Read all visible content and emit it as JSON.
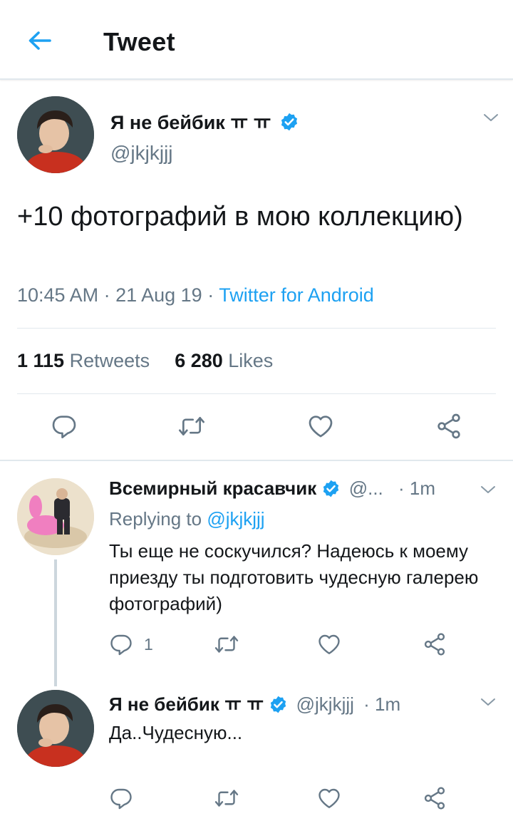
{
  "header": {
    "title": "Tweet"
  },
  "main_tweet": {
    "name": "Я не бейбик ㅠ ㅠ",
    "handle": "@jkjkjjj",
    "text": "+10 фотографий в мою коллекцию)",
    "time": "10:45 AM · 21 Aug 19 · ",
    "source": "Twitter for Android",
    "retweets_count": "1 115",
    "retweets_label": "Retweets",
    "likes_count": "6 280",
    "likes_label": "Likes"
  },
  "replies": [
    {
      "name": "Всемирный красавчик",
      "handle": "@...",
      "age": "· 1m",
      "replying_prefix": "Replying to ",
      "replying_to": "@jkjkjjj",
      "text": "Ты еще не соскучился? Надеюсь к моему приезду ты подготовить чудесную галерею фотографий)",
      "reply_count": "1"
    },
    {
      "name": "Я не бейбик ㅠ ㅠ",
      "handle": "@jkjkjjj",
      "age": "· 1m",
      "text": "Да..Чудесную..."
    }
  ],
  "colors": {
    "accent": "#1da1f2",
    "secondary": "#657786",
    "divider": "#e1e8ed"
  },
  "icons": [
    "back-arrow-icon",
    "verified-icon",
    "chevron-down-icon",
    "reply-icon",
    "retweet-icon",
    "like-icon",
    "share-icon"
  ]
}
